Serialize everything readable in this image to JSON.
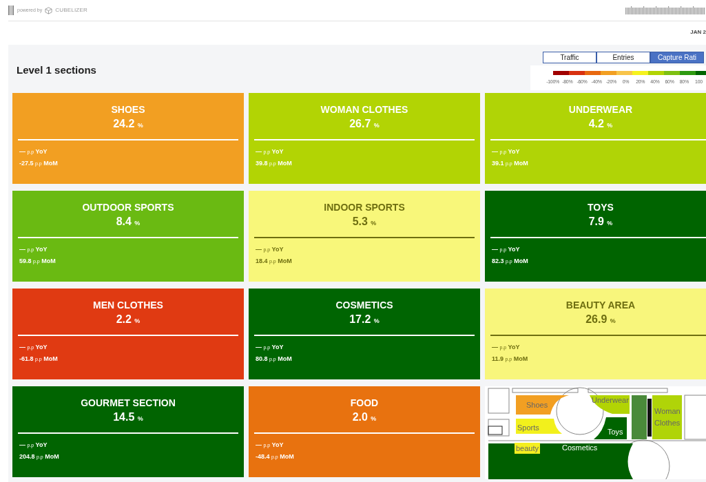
{
  "header": {
    "powered_by": "powered by",
    "brand": "CUBELIZER",
    "date": "JAN 2"
  },
  "panel": {
    "title": "Level 1 sections",
    "views": [
      {
        "label": "Traffic",
        "selected": false
      },
      {
        "label": "Entries",
        "selected": false
      },
      {
        "label": "Capture Rati",
        "selected": true
      }
    ],
    "legend": {
      "segments": [
        {
          "color": "#a00000"
        },
        {
          "color": "#d8300f"
        },
        {
          "color": "#e8680f"
        },
        {
          "color": "#f29f22"
        },
        {
          "color": "#f8c44a"
        },
        {
          "color": "#f6f21e"
        },
        {
          "color": "#b2d404"
        },
        {
          "color": "#7ec012"
        },
        {
          "color": "#2e9a10"
        },
        {
          "color": "#006400"
        }
      ],
      "ticks": [
        "-100%",
        "-80%",
        "-60%",
        "-40%",
        "-20%",
        "0%",
        "20%",
        "40%",
        "60%",
        "80%",
        "100"
      ]
    },
    "sections": [
      {
        "name": "SHOES",
        "value": "24.2",
        "unit": "%",
        "color": "#f29f22",
        "yoy": {
          "value": "—",
          "unit": "p.p",
          "label": "YoY"
        },
        "mom": {
          "value": "-27.5",
          "unit": "p.p",
          "label": "MoM"
        }
      },
      {
        "name": "WOMAN CLOTHES",
        "value": "26.7",
        "unit": "%",
        "color": "#b2d404",
        "yoy": {
          "value": "—",
          "unit": "p.p",
          "label": "YoY"
        },
        "mom": {
          "value": "39.8",
          "unit": "p.p",
          "label": "MoM"
        }
      },
      {
        "name": "UNDERWEAR",
        "value": "4.2",
        "unit": "%",
        "color": "#b0d406",
        "yoy": {
          "value": "—",
          "unit": "p.p",
          "label": "YoY"
        },
        "mom": {
          "value": "39.1",
          "unit": "p.p",
          "label": "MoM"
        }
      },
      {
        "name": "OUTDOOR SPORTS",
        "value": "8.4",
        "unit": "%",
        "color": "#6aba12",
        "yoy": {
          "value": "—",
          "unit": "p.p",
          "label": "YoY"
        },
        "mom": {
          "value": "59.8",
          "unit": "p.p",
          "label": "MoM"
        }
      },
      {
        "name": "INDOOR SPORTS",
        "value": "5.3",
        "unit": "%",
        "color": "#f8f77a",
        "yoy": {
          "value": "—",
          "unit": "p.p",
          "label": "YoY"
        },
        "mom": {
          "value": "18.4",
          "unit": "p.p",
          "label": "MoM"
        }
      },
      {
        "name": "TOYS",
        "value": "7.9",
        "unit": "%",
        "color": "#006400",
        "yoy": {
          "value": "—",
          "unit": "p.p",
          "label": "YoY"
        },
        "mom": {
          "value": "82.3",
          "unit": "p.p",
          "label": "MoM"
        }
      },
      {
        "name": "MEN CLOTHES",
        "value": "2.2",
        "unit": "%",
        "color": "#e03a12",
        "yoy": {
          "value": "—",
          "unit": "p.p",
          "label": "YoY"
        },
        "mom": {
          "value": "-61.8",
          "unit": "p.p",
          "label": "MoM"
        }
      },
      {
        "name": "COSMETICS",
        "value": "17.2",
        "unit": "%",
        "color": "#006502",
        "yoy": {
          "value": "—",
          "unit": "p.p",
          "label": "YoY"
        },
        "mom": {
          "value": "80.8",
          "unit": "p.p",
          "label": "MoM"
        }
      },
      {
        "name": "BEAUTY AREA",
        "value": "26.9",
        "unit": "%",
        "color": "#f8f67c",
        "yoy": {
          "value": "—",
          "unit": "p.p",
          "label": "YoY"
        },
        "mom": {
          "value": "11.9",
          "unit": "p.p",
          "label": "MoM"
        }
      },
      {
        "name": "GOURMET SECTION",
        "value": "14.5",
        "unit": "%",
        "color": "#016401",
        "yoy": {
          "value": "—",
          "unit": "p.p",
          "label": "YoY"
        },
        "mom": {
          "value": "204.8",
          "unit": "p.p",
          "label": "MoM"
        }
      },
      {
        "name": "FOOD",
        "value": "2.0",
        "unit": "%",
        "color": "#e8720f",
        "yoy": {
          "value": "—",
          "unit": "p.p",
          "label": "YoY"
        },
        "mom": {
          "value": "-48.4",
          "unit": "p.p",
          "label": "MoM"
        }
      }
    ],
    "map": {
      "areas": [
        {
          "label": "Shoes",
          "color": "#f29f22"
        },
        {
          "label": "Sports",
          "color": "#f2f01c"
        },
        {
          "label": "beauty",
          "color": "#f4ee20"
        },
        {
          "label": "Underwear",
          "color": "#b2d404"
        },
        {
          "label": "Toys",
          "color": "#006400"
        },
        {
          "label": "Woman Clothes",
          "color": "#b0d408"
        },
        {
          "label": "Cosmetics",
          "color": "#005f00"
        }
      ]
    }
  }
}
